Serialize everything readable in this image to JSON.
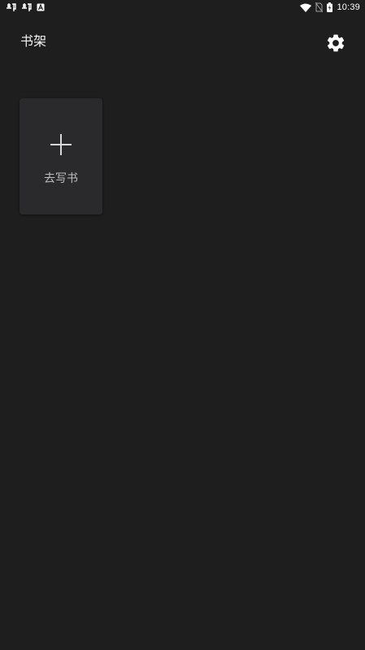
{
  "status_bar": {
    "time": "10:39",
    "left_icons": [
      "bug-notification-icon",
      "bug-notification-icon",
      "font-a-icon"
    ],
    "right_icons": [
      "wifi-icon",
      "no-sim-icon",
      "battery-icon"
    ]
  },
  "header": {
    "title": "书架",
    "settings_icon": "gear-icon"
  },
  "bookshelf": {
    "new_book_card": {
      "icon": "plus-icon",
      "label": "去写书"
    }
  },
  "colors": {
    "background": "#1e1e1e",
    "card": "#2a2a2c",
    "text_primary": "#f2f2f2",
    "text_secondary": "#bdbdbd"
  }
}
